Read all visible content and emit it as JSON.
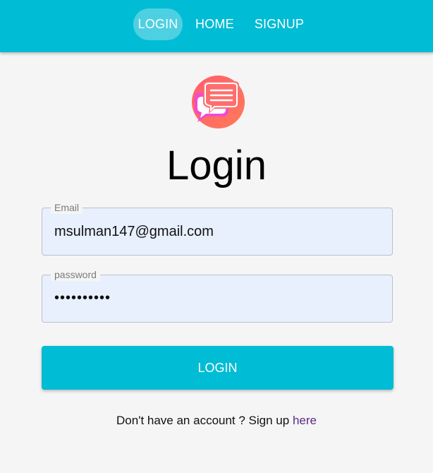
{
  "nav": {
    "items": [
      {
        "label": "LOGIN",
        "active": true
      },
      {
        "label": "HOME",
        "active": false
      },
      {
        "label": "SIGNUP",
        "active": false
      }
    ]
  },
  "logo": {
    "icon": "chat-bubbles-icon"
  },
  "page": {
    "title": "Login"
  },
  "form": {
    "email": {
      "label": "Email",
      "value": "msulman147@gmail.com"
    },
    "password": {
      "label": "password",
      "value": "••••••••••"
    },
    "submit_label": "LOGIN"
  },
  "footer": {
    "prompt": "Don't have an account ? Sign up",
    "link_label": "here"
  },
  "colors": {
    "primary": "#00bcd4",
    "background": "#f5f5f5",
    "input_fill": "#e8f0fe",
    "link": "#5b2a86"
  }
}
